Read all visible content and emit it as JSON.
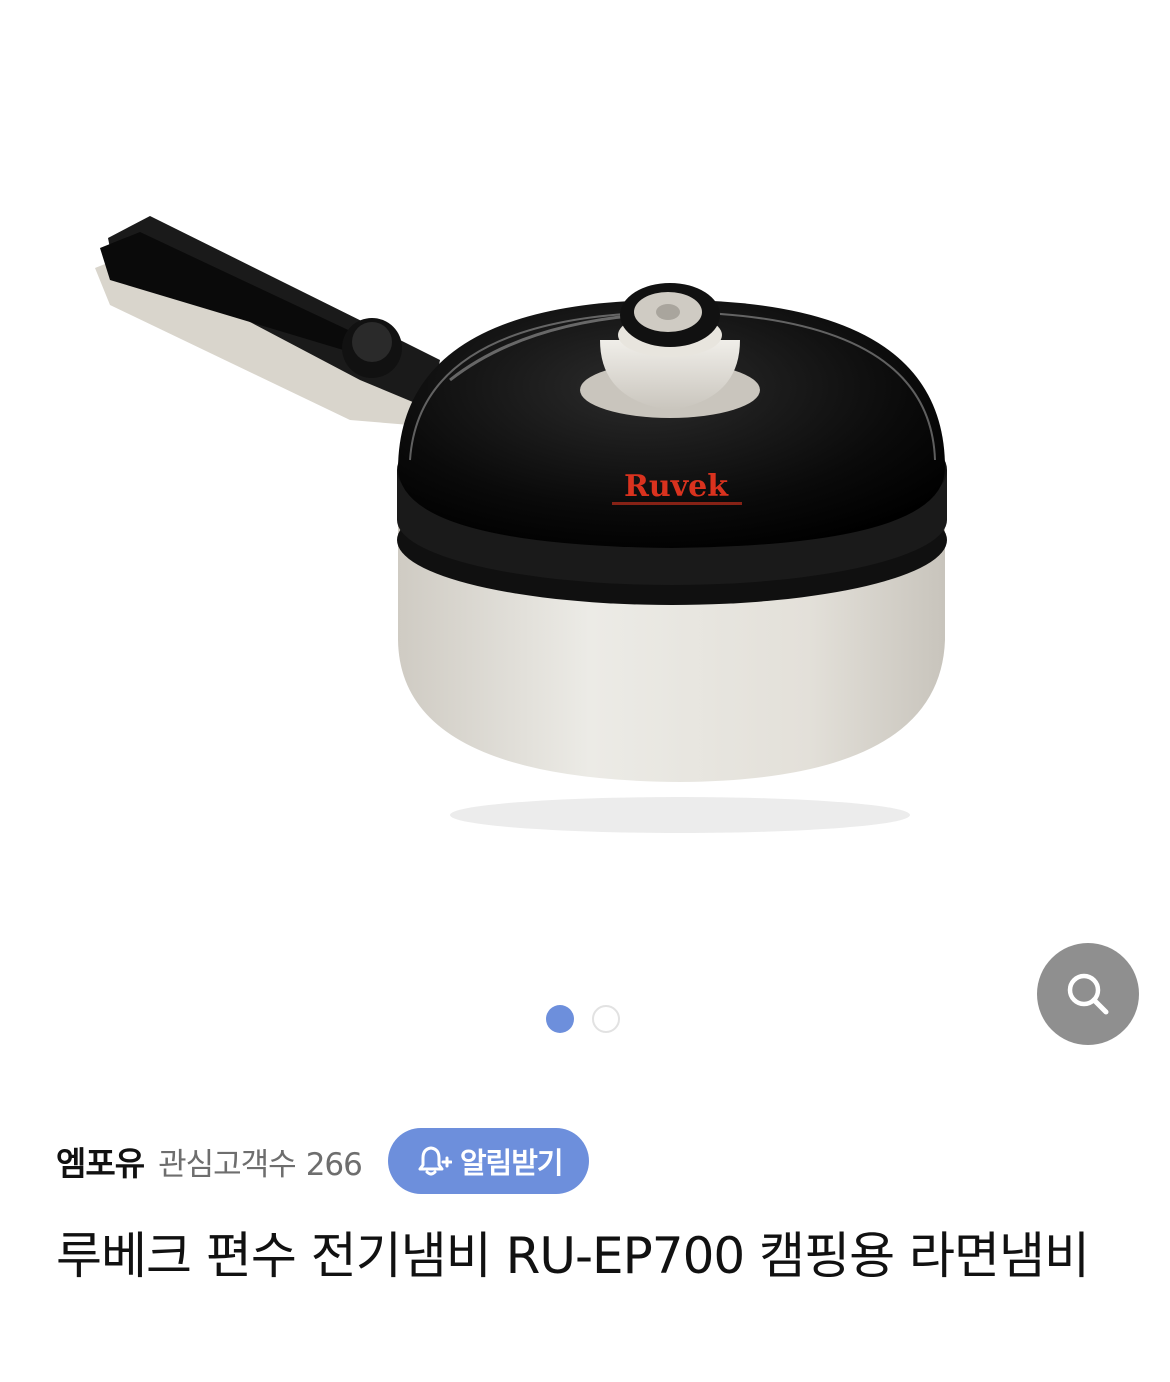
{
  "gallery": {
    "brand_logo_text": "Ruvek",
    "current_page": 1,
    "total_pages": 2,
    "zoom_icon": "search-icon"
  },
  "seller": {
    "name": "엠포유",
    "followers_label": "관심고객수",
    "followers_count": "266",
    "alarm_button_label": "알림받기",
    "alarm_icon": "bell-plus-icon"
  },
  "product": {
    "title": "루베크 편수 전기냄비 RU-EP700 캠핑용 라면냄비"
  },
  "colors": {
    "accent": "#6d8fdc",
    "zoom_button": "#8f8f8f",
    "pot_body": "#e8e5de",
    "lid_dark": "#0e0e0e",
    "logo_red": "#d9321e"
  }
}
